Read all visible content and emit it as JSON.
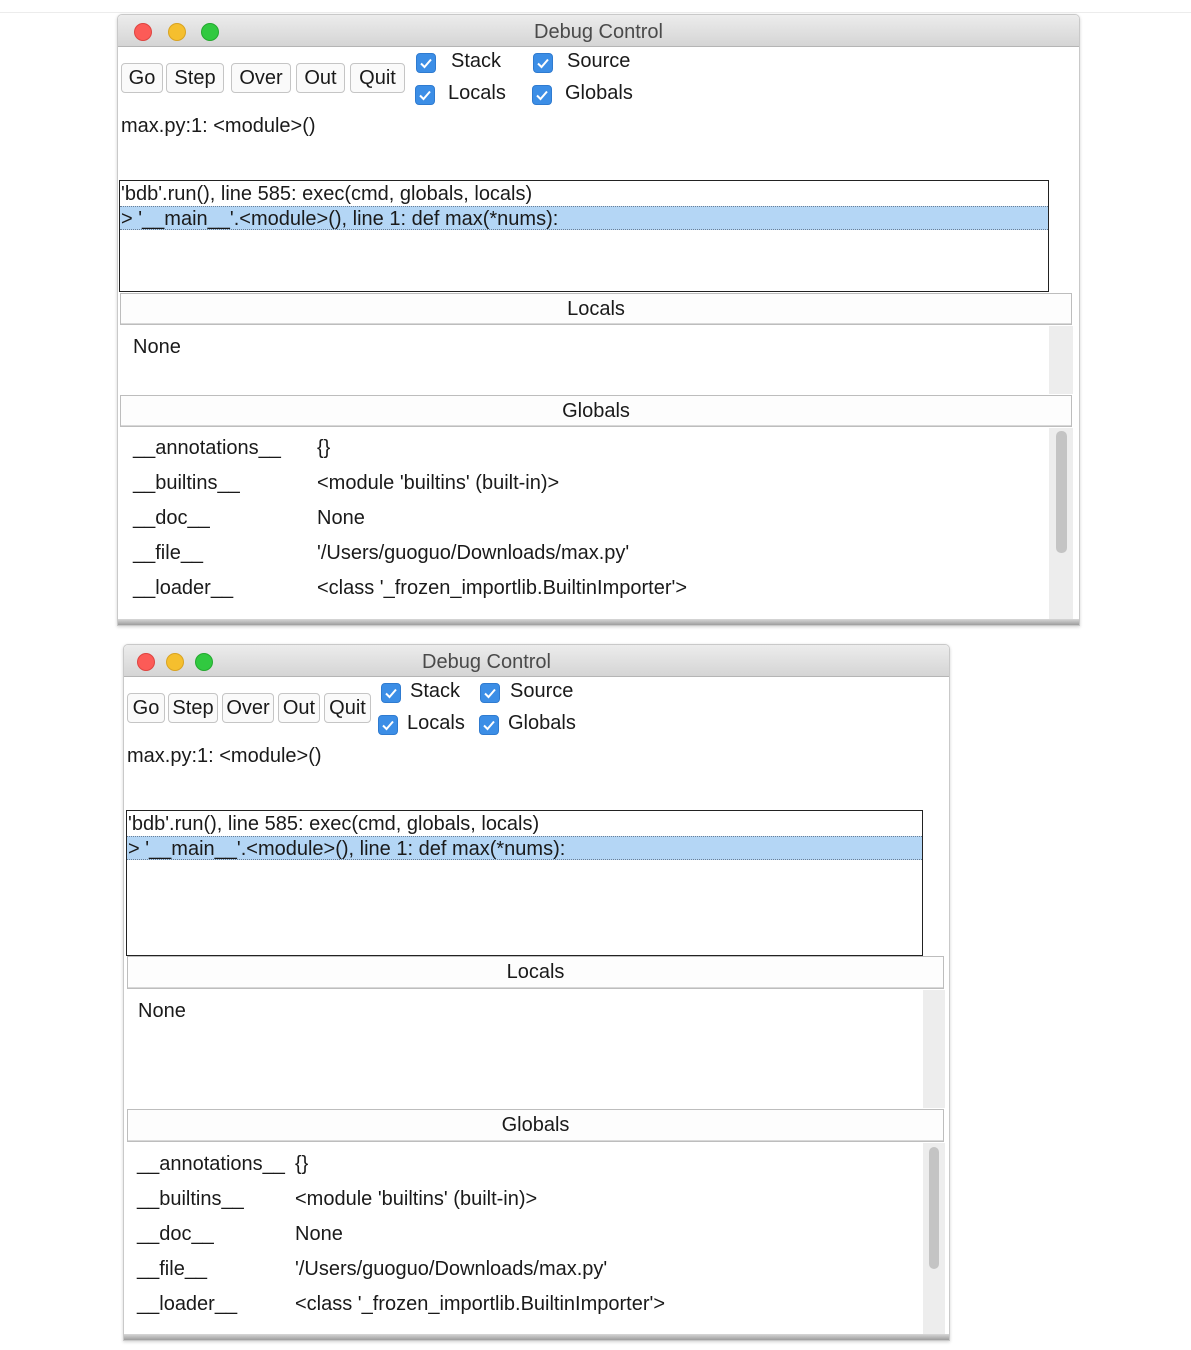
{
  "windows": [
    {
      "title": "Debug Control",
      "toolbar": {
        "go": "Go",
        "step": "Step",
        "over": "Over",
        "out": "Out",
        "quit": "Quit"
      },
      "checkboxes": {
        "stack": "Stack",
        "source": "Source",
        "locals": "Locals",
        "globals": "Globals"
      },
      "status": "max.py:1: <module>()",
      "stack_rows": [
        "'bdb'.run(), line 585: exec(cmd, globals, locals)",
        "> '__main__'.<module>(), line 1: def max(*nums):"
      ],
      "locals_header": "Locals",
      "locals_value": "None",
      "globals_header": "Globals",
      "globals_rows": [
        {
          "name": "__annotations__",
          "value": "{}"
        },
        {
          "name": "__builtins__",
          "value": "<module 'builtins' (built-in)>"
        },
        {
          "name": "__doc__",
          "value": "None"
        },
        {
          "name": "__file__",
          "value": "'/Users/guoguo/Downloads/max.py'"
        },
        {
          "name": "__loader__",
          "value": "<class '_frozen_importlib.BuiltinImporter'>"
        }
      ]
    },
    {
      "title": "Debug Control",
      "toolbar": {
        "go": "Go",
        "step": "Step",
        "over": "Over",
        "out": "Out",
        "quit": "Quit"
      },
      "checkboxes": {
        "stack": "Stack",
        "source": "Source",
        "locals": "Locals",
        "globals": "Globals"
      },
      "status": "max.py:1: <module>()",
      "stack_rows": [
        "'bdb'.run(), line 585: exec(cmd, globals, locals)",
        "> '__main__'.<module>(), line 1: def max(*nums):"
      ],
      "locals_header": "Locals",
      "locals_value": "None",
      "globals_header": "Globals",
      "globals_rows": [
        {
          "name": "__annotations__",
          "value": "{}"
        },
        {
          "name": "__builtins__",
          "value": "<module 'builtins' (built-in)>"
        },
        {
          "name": "__doc__",
          "value": "None"
        },
        {
          "name": "__file__",
          "value": "'/Users/guoguo/Downloads/max.py'"
        },
        {
          "name": "__loader__",
          "value": "<class '_frozen_importlib.BuiltinImporter'>"
        }
      ]
    }
  ]
}
